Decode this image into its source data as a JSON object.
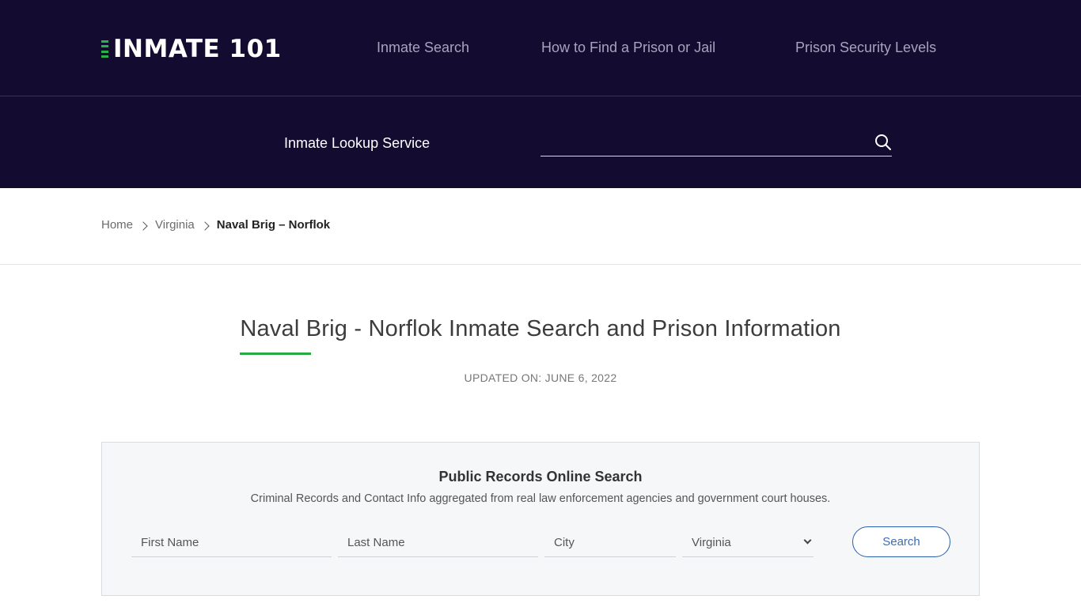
{
  "header": {
    "logo_text": "INMATE 101",
    "nav": [
      {
        "label": "Inmate Search"
      },
      {
        "label": "How to Find a Prison or Jail"
      },
      {
        "label": "Prison Security Levels"
      }
    ],
    "lookup_label": "Inmate Lookup Service",
    "lookup_input_value": "",
    "lookup_icon": "search-icon"
  },
  "breadcrumb": {
    "items": [
      {
        "label": "Home"
      },
      {
        "label": "Virginia"
      }
    ],
    "current": "Naval Brig – Norflok"
  },
  "main": {
    "title": "Naval Brig - Norflok Inmate Search and Prison Information",
    "updated": "UPDATED ON: JUNE 6, 2022"
  },
  "search_panel": {
    "title": "Public Records Online Search",
    "subtitle": "Criminal Records and Contact Info aggregated from real law enforcement agencies and government court houses.",
    "first_name_placeholder": "First Name",
    "last_name_placeholder": "Last Name",
    "city_placeholder": "City",
    "state_selected": "Virginia",
    "search_button": "Search"
  },
  "colors": {
    "header_bg": "#140b30",
    "accent_green": "#29a844",
    "button_blue": "#3b6cb7"
  }
}
